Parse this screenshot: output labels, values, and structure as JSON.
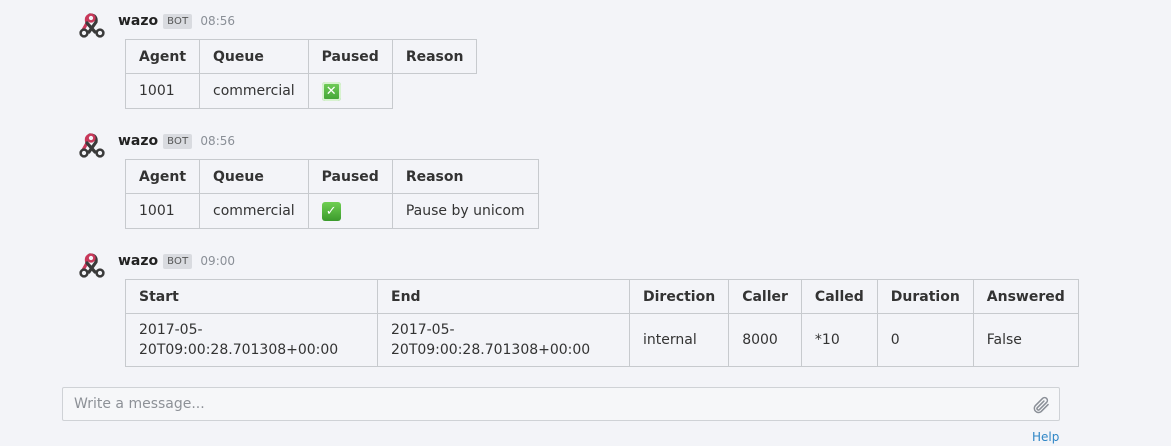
{
  "messages": [
    {
      "username": "wazo",
      "badge": "BOT",
      "time": "08:56",
      "table": {
        "headers": [
          "Agent",
          "Queue",
          "Paused",
          "Reason"
        ],
        "row": {
          "agent": "1001",
          "queue": "commercial",
          "paused_icon": "cross-mark-button-emoji",
          "reason": ""
        }
      }
    },
    {
      "username": "wazo",
      "badge": "BOT",
      "time": "08:56",
      "table": {
        "headers": [
          "Agent",
          "Queue",
          "Paused",
          "Reason"
        ],
        "row": {
          "agent": "1001",
          "queue": "commercial",
          "paused_icon": "check-mark-button-emoji",
          "reason": "Pause by unicom"
        }
      }
    },
    {
      "username": "wazo",
      "badge": "BOT",
      "time": "09:00",
      "table": {
        "headers": [
          "Start",
          "End",
          "Direction",
          "Caller",
          "Called",
          "Duration",
          "Answered"
        ],
        "row": {
          "start_line1": "2017-05-",
          "start_line2": "20T09:00:28.701308+00:00",
          "end_line1": "2017-05-",
          "end_line2": "20T09:00:28.701308+00:00",
          "direction": "internal",
          "caller": "8000",
          "called": "*10",
          "duration": "0",
          "answered": "False"
        }
      }
    }
  ],
  "composer": {
    "placeholder": "Write a message...",
    "attach_icon": "paperclip-icon"
  },
  "footer": {
    "help_label": "Help"
  },
  "colors": {
    "background": "#f3f4f8",
    "border": "#c7cace",
    "link": "#2f86c6",
    "avatar": "#c8385a"
  }
}
